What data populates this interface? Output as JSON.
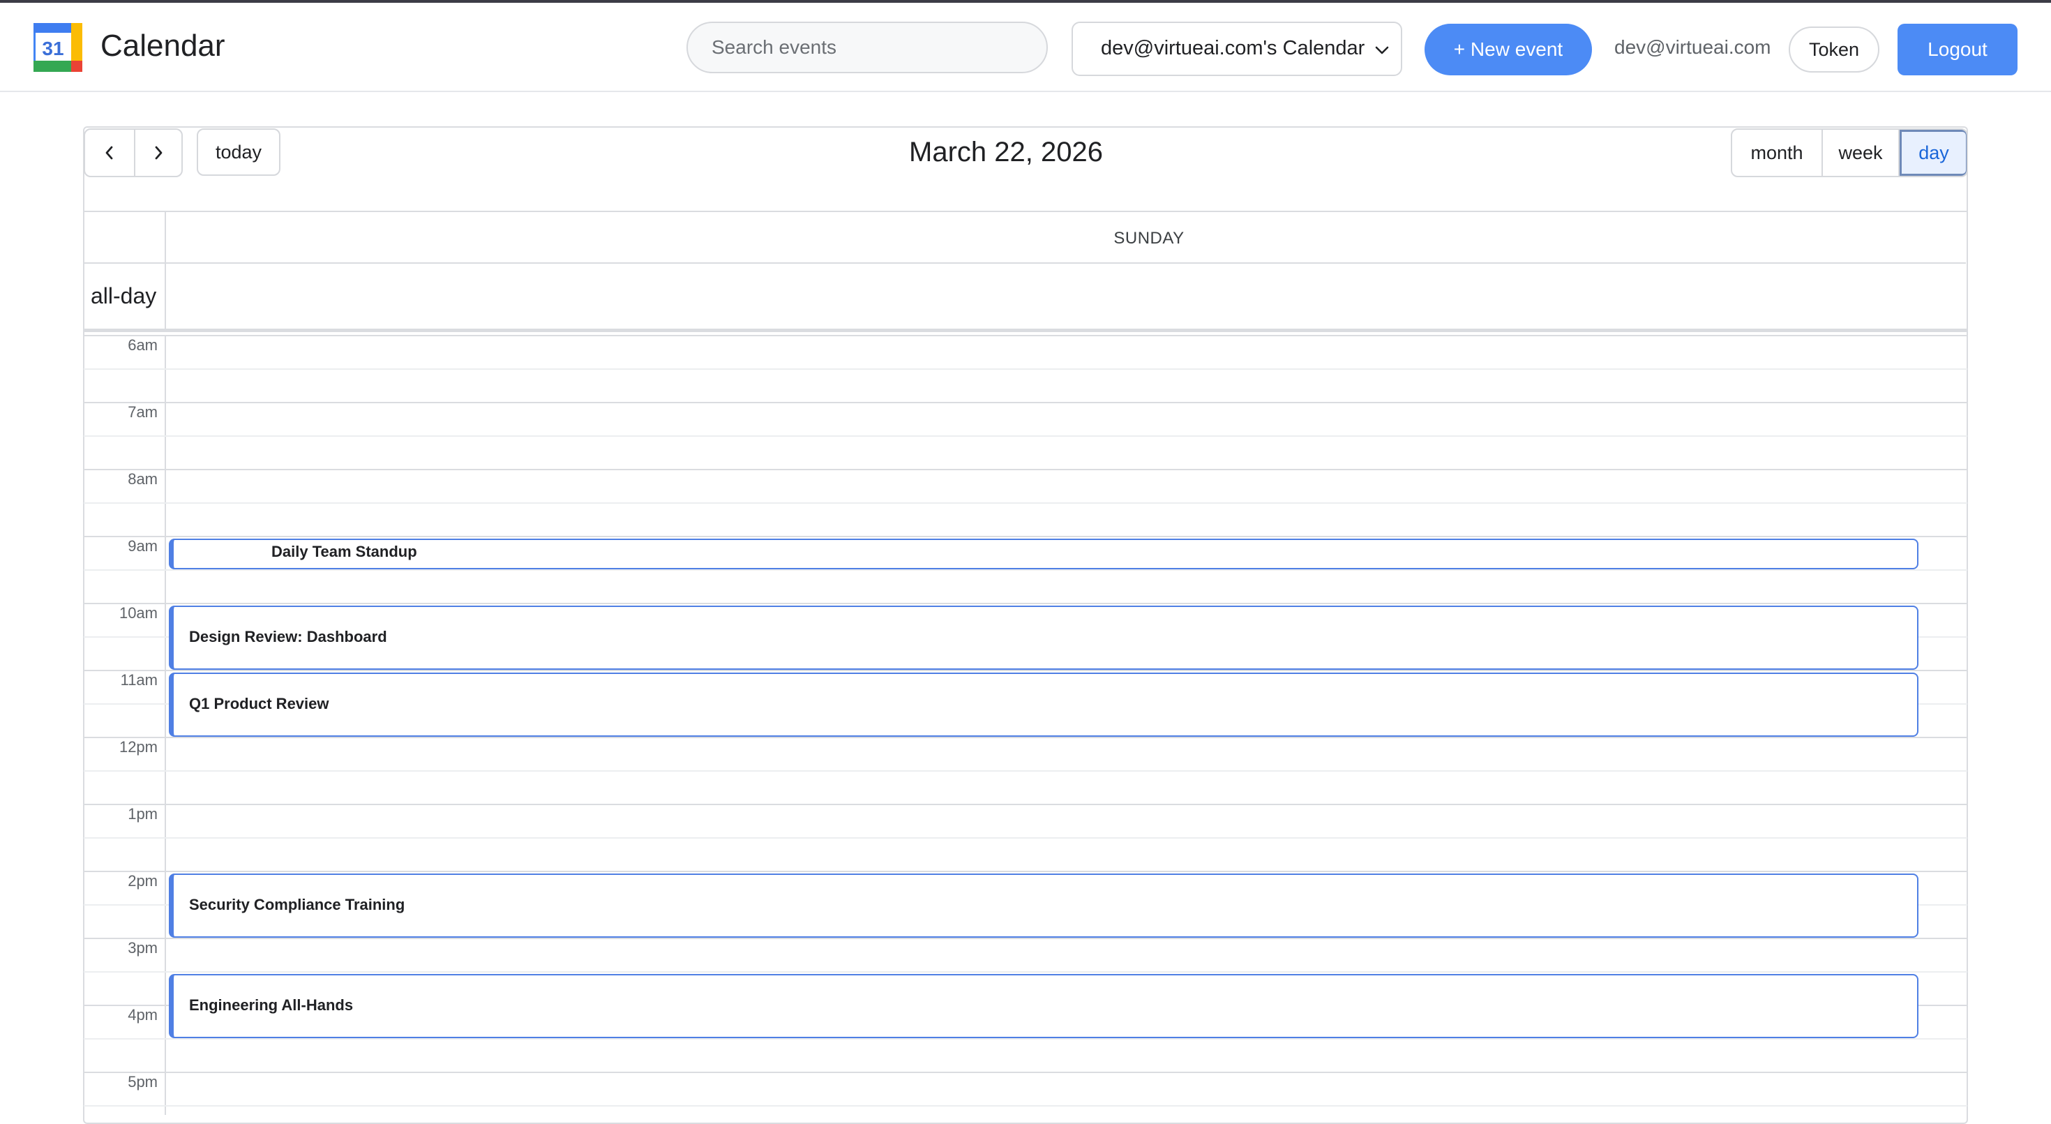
{
  "app": {
    "title": "Calendar",
    "logo_text": "31"
  },
  "header": {
    "search_placeholder": "Search events",
    "calendar_selector": "dev@virtueai.com's Calendar",
    "new_event_label": "+ New event",
    "user_email": "dev@virtueai.com",
    "token_label": "Token",
    "logout_label": "Logout"
  },
  "toolbar": {
    "today_label": "today",
    "date_title": "March 22, 2026",
    "views": {
      "month": "month",
      "week": "week",
      "day": "day"
    },
    "active_view": "day"
  },
  "grid": {
    "day_name": "SUNDAY",
    "allday_label": "all-day",
    "hours": [
      "6am",
      "7am",
      "8am",
      "9am",
      "10am",
      "11am",
      "12pm",
      "1pm",
      "2pm",
      "3pm",
      "4pm",
      "5pm"
    ]
  },
  "events": [
    {
      "title": "Daily Team Standup",
      "start": "9:00",
      "end": "9:30"
    },
    {
      "title": "Design Review: Dashboard",
      "start": "10:00",
      "end": "11:00"
    },
    {
      "title": "Q1 Product Review",
      "start": "11:00",
      "end": "12:00"
    },
    {
      "title": "Security Compliance Training",
      "start": "14:00",
      "end": "15:00"
    },
    {
      "title": "Engineering All-Hands",
      "start": "15:30",
      "end": "16:30"
    }
  ],
  "colors": {
    "accent": "#4c8bf5",
    "event_border": "#4f7fe4",
    "grid_line": "#dadce0"
  }
}
